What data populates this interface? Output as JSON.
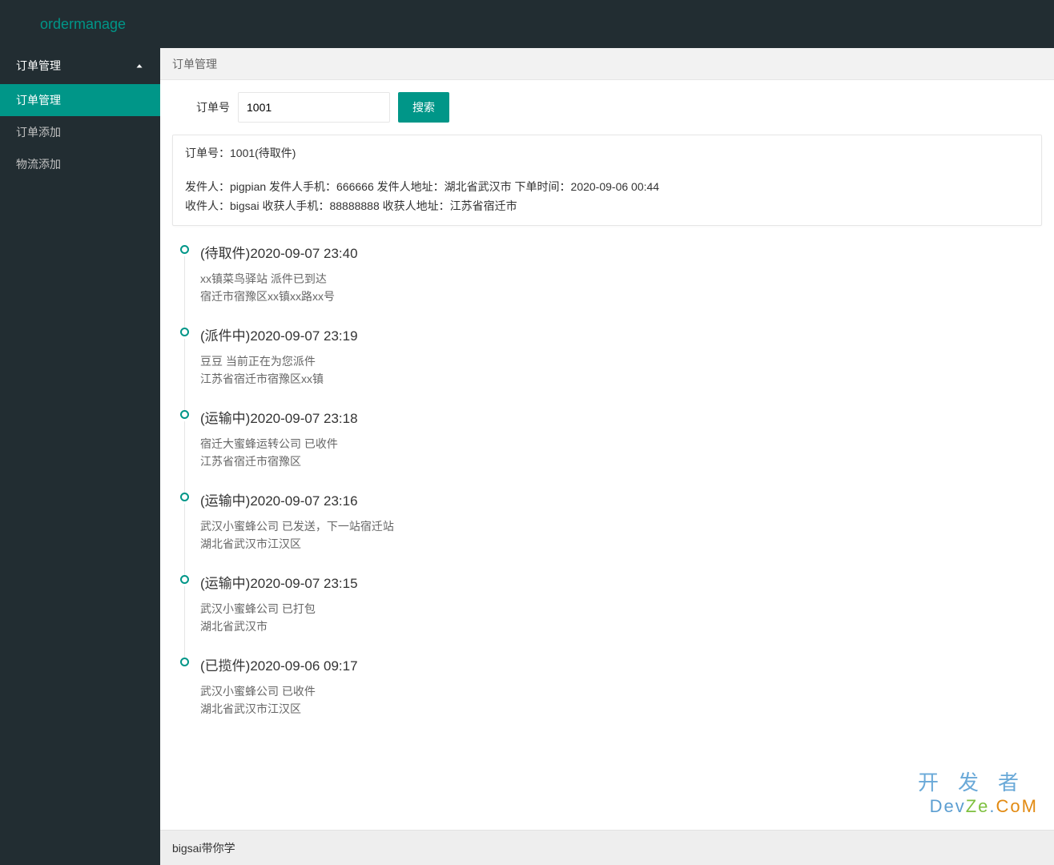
{
  "header": {
    "brand": "ordermanage"
  },
  "sidebar": {
    "group": "订单管理",
    "items": [
      {
        "label": "订单管理",
        "active": true
      },
      {
        "label": "订单添加",
        "active": false
      },
      {
        "label": "物流添加",
        "active": false
      }
    ]
  },
  "breadcrumb": "订单管理",
  "search": {
    "label": "订单号",
    "value": "1001",
    "button": "搜索"
  },
  "order": {
    "line1": "订单号：1001(待取件)",
    "line2": "发件人：pigpian 发件人手机：666666 发件人地址：湖北省武汉市 下单时间：2020-09-06 00:44",
    "line3": "收件人：bigsai 收获人手机：88888888 收获人地址：江苏省宿迁市"
  },
  "timeline": [
    {
      "title": "(待取件)2020-09-07 23:40",
      "text1": "xx镇菜鸟驿站 派件已到达",
      "text2": "宿迁市宿豫区xx镇xx路xx号"
    },
    {
      "title": "(派件中)2020-09-07 23:19",
      "text1": "豆豆 当前正在为您派件",
      "text2": "江苏省宿迁市宿豫区xx镇"
    },
    {
      "title": "(运输中)2020-09-07 23:18",
      "text1": "宿迁大蜜蜂运转公司 已收件",
      "text2": "江苏省宿迁市宿豫区"
    },
    {
      "title": "(运输中)2020-09-07 23:16",
      "text1": "武汉小蜜蜂公司 已发送，下一站宿迁站",
      "text2": "湖北省武汉市江汉区"
    },
    {
      "title": "(运输中)2020-09-07 23:15",
      "text1": "武汉小蜜蜂公司 已打包",
      "text2": "湖北省武汉市"
    },
    {
      "title": "(已揽件)2020-09-06 09:17",
      "text1": "武汉小蜜蜂公司 已收件",
      "text2": "湖北省武汉市江汉区"
    }
  ],
  "footer": "bigsai带你学",
  "watermark": {
    "cn": "开发者",
    "en_d": "Dev",
    "en_z": "Ze",
    "en_dot": ".",
    "en_c": "CoM"
  }
}
